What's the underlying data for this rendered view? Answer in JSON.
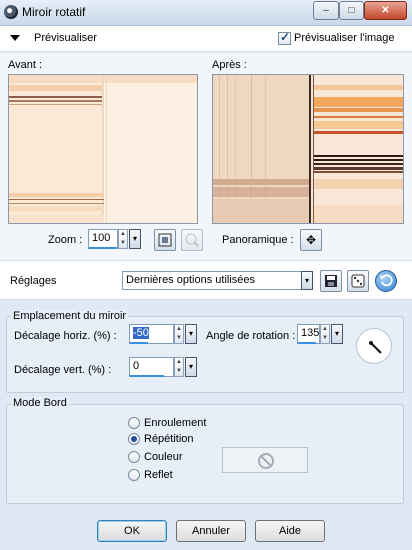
{
  "window": {
    "title": "Miroir rotatif",
    "minimize": "–",
    "maximize": "□",
    "close": "✕"
  },
  "preview": {
    "toggle_label": "Prévisualiser",
    "preview_image_label": "Prévisualiser l'image",
    "preview_image_checked": true
  },
  "panes": {
    "before_label": "Avant :",
    "after_label": "Après :"
  },
  "zoom": {
    "label": "Zoom :",
    "value": "100"
  },
  "pan": {
    "label": "Panoramique :",
    "icon": "move-icon"
  },
  "settings": {
    "label": "Réglages",
    "preset": "Dernières options utilisées"
  },
  "mirror_location": {
    "legend": "Emplacement du miroir",
    "horiz_label": "Décalage horiz. (%) :",
    "horiz_value": "-50",
    "vert_label": "Décalage vert. (%) :",
    "vert_value": "0",
    "angle_label": "Angle de rotation :",
    "angle_value": "135"
  },
  "edge_mode": {
    "legend": "Mode Bord",
    "options": [
      "Enroulement",
      "Répétition",
      "Couleur",
      "Reflet"
    ],
    "selected": "Répétition"
  },
  "buttons": {
    "ok": "OK",
    "cancel": "Annuler",
    "help": "Aide"
  }
}
